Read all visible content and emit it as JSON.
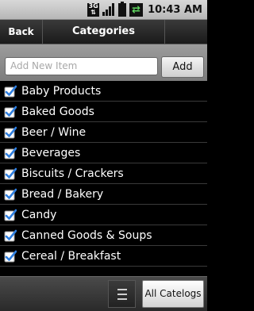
{
  "status_bar": {
    "network": "3G",
    "time": "10:43 AM"
  },
  "title_bar": {
    "back_label": "Back",
    "title": "Categories"
  },
  "add_bar": {
    "placeholder": "Add New Item",
    "add_label": "Add"
  },
  "categories": [
    {
      "label": "Baby Products",
      "checked": true
    },
    {
      "label": "Baked Goods",
      "checked": true
    },
    {
      "label": "Beer / Wine",
      "checked": true
    },
    {
      "label": "Beverages",
      "checked": true
    },
    {
      "label": "Biscuits / Crackers",
      "checked": true
    },
    {
      "label": "Bread / Bakery",
      "checked": true
    },
    {
      "label": "Candy",
      "checked": true
    },
    {
      "label": "Canned Goods & Soups",
      "checked": true
    },
    {
      "label": "Cereal / Breakfast",
      "checked": true
    }
  ],
  "bottom_bar": {
    "all_catalogs_label": "All Catelogs"
  },
  "colors": {
    "checkmark": "#2f7fe0",
    "background": "#000000"
  }
}
